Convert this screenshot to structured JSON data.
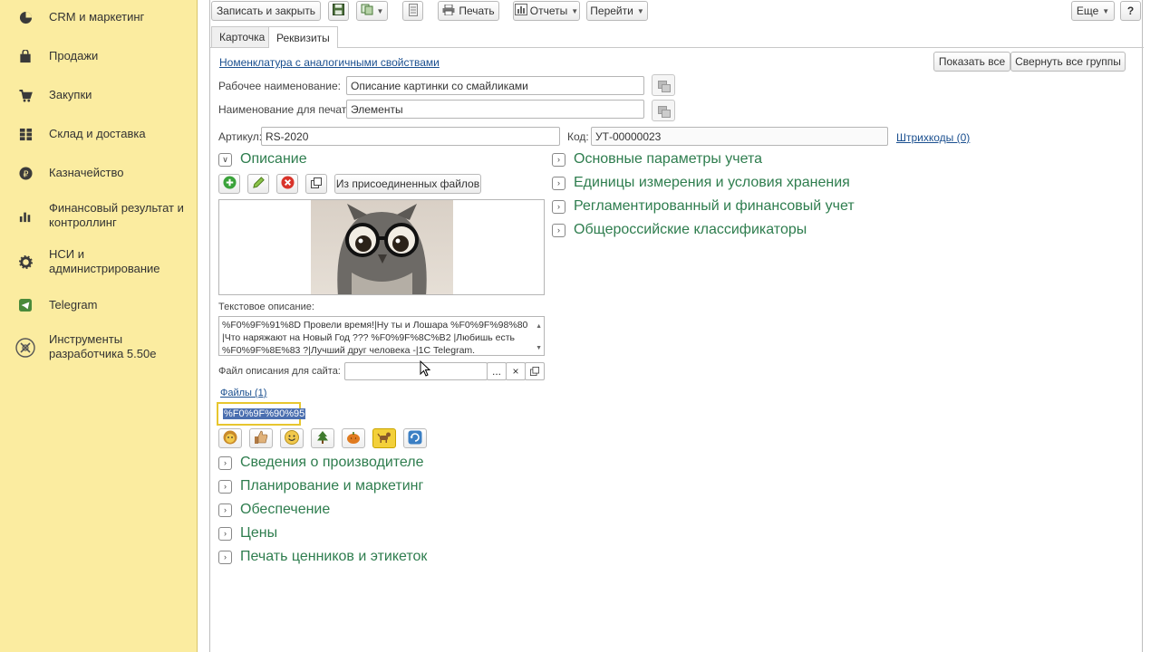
{
  "sidebar": {
    "items": [
      {
        "label": "CRM и маркетинг",
        "icon": "pie-chart-icon"
      },
      {
        "label": "Продажи",
        "icon": "shopping-bag-icon"
      },
      {
        "label": "Закупки",
        "icon": "cart-icon"
      },
      {
        "label": "Склад и доставка",
        "icon": "grid-icon"
      },
      {
        "label": "Казначейство",
        "icon": "ruble-icon"
      },
      {
        "label": "Финансовый результат и\nконтроллинг",
        "icon": "bar-chart-icon"
      },
      {
        "label": "НСИ и\nадминистрирование",
        "icon": "gear-icon"
      },
      {
        "label": "Telegram",
        "icon": "telegram-icon"
      },
      {
        "label": "Инструменты\nразработчика 5.50е",
        "icon": "dev-tools-icon"
      }
    ]
  },
  "toolbar": {
    "save_close": "Записать и закрыть",
    "print": "Печать",
    "reports": "Отчеты",
    "goto": "Перейти",
    "more": "Еще",
    "help": "?"
  },
  "tabs": [
    "Карточка",
    "Реквизиты"
  ],
  "header": {
    "similar_link": "Номенклатура с аналогичными свойствами",
    "show_all": "Показать все",
    "collapse_all": "Свернуть все группы"
  },
  "form": {
    "work_name_label": "Рабочее наименование:",
    "work_name_value": "Описание картинки со смайликами",
    "print_name_label": "Наименование для печати:",
    "print_name_value": "Элементы",
    "article_label": "Артикул:",
    "article_value": "RS-2020",
    "code_label": "Код:",
    "code_value": "УТ-00000023",
    "barcodes_link": "Штрихкоды (0)"
  },
  "description": {
    "title": "Описание",
    "from_files": "Из присоединенных файлов",
    "text_label": "Текстовое описание:",
    "text_value": "%F0%9F%91%8D Провели время!|Ну ты и Лошара %F0%9F%98%80 |Что  наряжают на Новый Год ??? %F0%9F%8C%B2  |Любишь есть %F0%9F%8E%83 ?|Лучший друг человека -|1С Telegram.",
    "site_file_label": "Файл описания для сайта:",
    "files_link": "Файлы (1)",
    "selected_file": "%F0%9F%90%95"
  },
  "right_sections": [
    "Основные параметры учета",
    "Единицы измерения и условия хранения",
    "Регламентированный и финансовый учет",
    "Общероссийские классификаторы"
  ],
  "bottom_sections": [
    "Сведения о производителе",
    "Планирование и маркетинг",
    "Обеспечение",
    "Цены",
    "Печать ценников и этикеток"
  ],
  "emoji_buttons": [
    {
      "icon": "lion-face-icon",
      "color": "#e8b33c"
    },
    {
      "icon": "thumbs-up-icon",
      "color": "#d7a86e"
    },
    {
      "icon": "smile-face-icon",
      "color": "#f2c94c"
    },
    {
      "icon": "christmas-tree-icon",
      "color": "#3f7a2e"
    },
    {
      "icon": "pumpkin-icon",
      "color": "#e07b1f"
    },
    {
      "icon": "dog-icon",
      "color": "#d9a441"
    },
    {
      "icon": "refresh-icon",
      "color": "#3b7fc4"
    }
  ]
}
